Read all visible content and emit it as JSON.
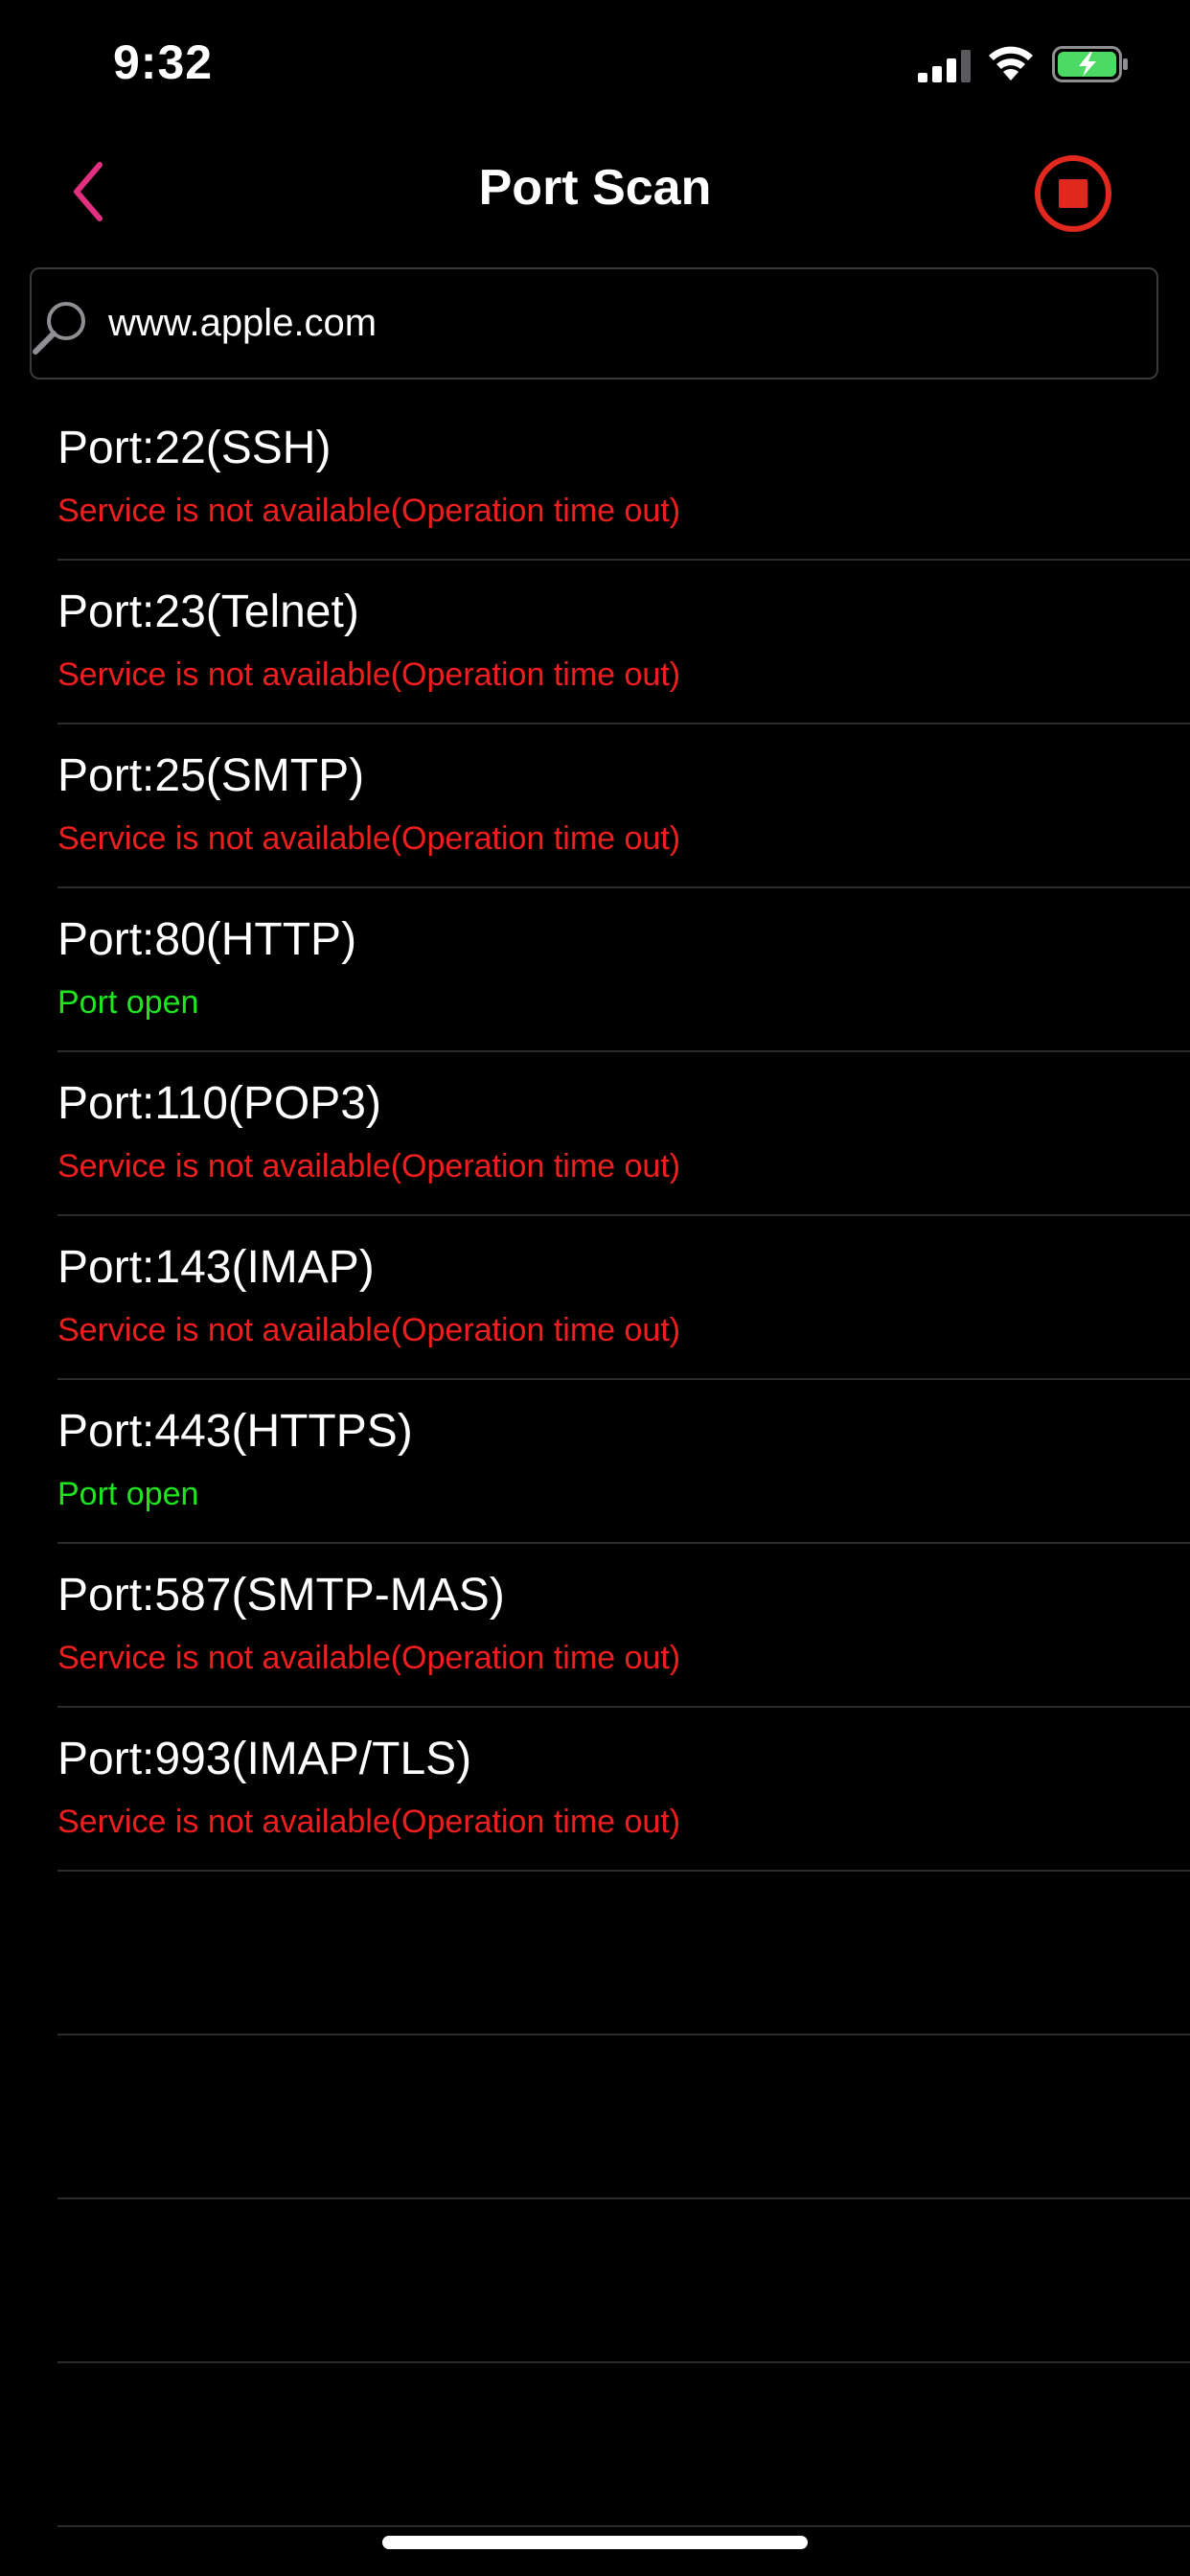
{
  "status_bar": {
    "time": "9:32",
    "signal_icon": "cellular-signal-icon",
    "wifi_icon": "wifi-icon",
    "battery_icon": "battery-charging-icon",
    "battery_color": "#4cd964"
  },
  "nav": {
    "title": "Port Scan",
    "back_icon": "chevron-left-icon",
    "back_color": "#e0307f",
    "stop_icon": "stop-icon",
    "stop_color": "#e0281e"
  },
  "search": {
    "icon": "search-icon",
    "value": "www.apple.com"
  },
  "colors": {
    "closed": "#f01e1e",
    "open": "#1ee61e"
  },
  "ports": [
    {
      "name": "Port:22(SSH)",
      "status": "Service is not available(Operation time out)",
      "state": "closed"
    },
    {
      "name": "Port:23(Telnet)",
      "status": "Service is not available(Operation time out)",
      "state": "closed"
    },
    {
      "name": "Port:25(SMTP)",
      "status": "Service is not available(Operation time out)",
      "state": "closed"
    },
    {
      "name": "Port:80(HTTP)",
      "status": "Port open",
      "state": "open"
    },
    {
      "name": "Port:110(POP3)",
      "status": "Service is not available(Operation time out)",
      "state": "closed"
    },
    {
      "name": "Port:143(IMAP)",
      "status": "Service is not available(Operation time out)",
      "state": "closed"
    },
    {
      "name": "Port:443(HTTPS)",
      "status": "Port open",
      "state": "open"
    },
    {
      "name": "Port:587(SMTP-MAS)",
      "status": "Service is not available(Operation time out)",
      "state": "closed"
    },
    {
      "name": "Port:993(IMAP/TLS)",
      "status": "Service is not available(Operation time out)",
      "state": "closed"
    }
  ],
  "empty_rows": 4
}
